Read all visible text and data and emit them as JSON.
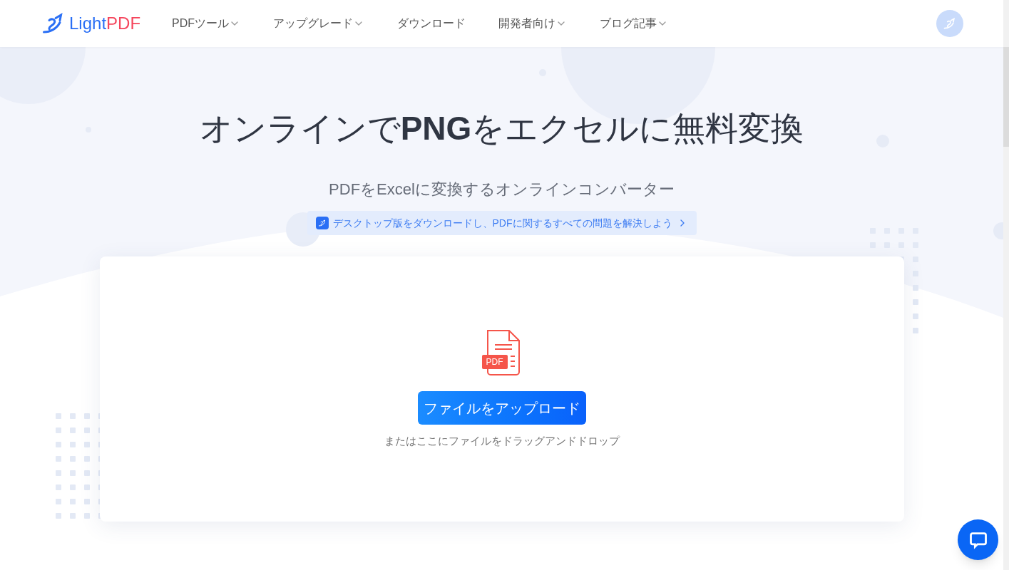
{
  "logo": {
    "part_1": "Light",
    "part_2": "PDF"
  },
  "nav": [
    {
      "label": "PDFツール",
      "dropdown": true
    },
    {
      "label": "アップグレード",
      "dropdown": true
    },
    {
      "label": "ダウンロード",
      "dropdown": false
    },
    {
      "label": "開発者向け",
      "dropdown": true
    },
    {
      "label": "ブログ記事",
      "dropdown": true
    }
  ],
  "hero": {
    "title_start": "オンラインで",
    "title_bold": "PNG",
    "title_end": "をエクセルに無料変換",
    "subtitle": "PDFをExcelに変換するオンラインコンバーター",
    "banner": "デスクトップ版をダウンロードし、PDFに関するすべての問題を解決しよう"
  },
  "upload": {
    "file_badge": "PDF",
    "button": "ファイルをアップロード",
    "hint": "またはここにファイルをドラッグアンドドロップ"
  }
}
